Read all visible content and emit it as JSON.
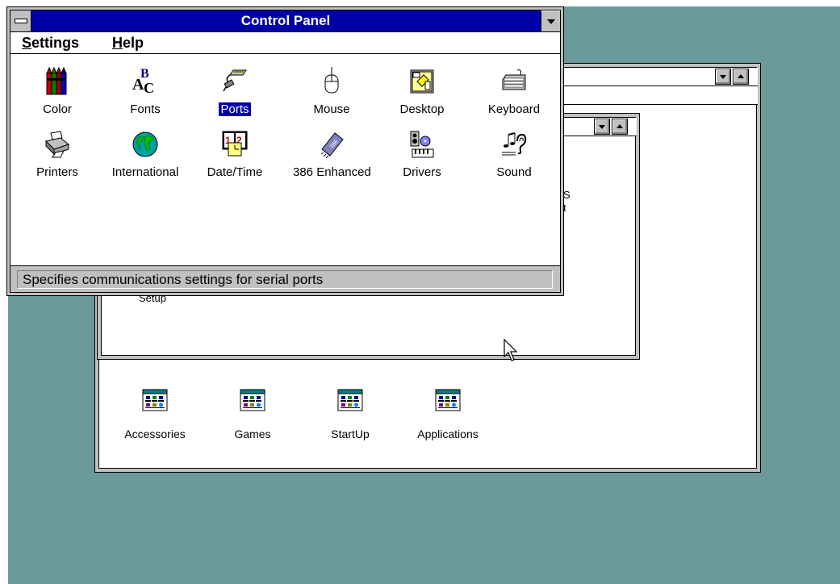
{
  "control_panel": {
    "title": "Control Panel",
    "menu": [
      {
        "label": "Settings",
        "accel": "S",
        "rest": "ettings"
      },
      {
        "label": "Help",
        "accel": "H",
        "rest": "elp"
      }
    ],
    "items": [
      {
        "label": "Color",
        "icon": "color-crayons-icon"
      },
      {
        "label": "Fonts",
        "icon": "fonts-icon"
      },
      {
        "label": "Ports",
        "icon": "ports-icon",
        "selected": true
      },
      {
        "label": "Mouse",
        "icon": "mouse-icon"
      },
      {
        "label": "Desktop",
        "icon": "desktop-icon"
      },
      {
        "label": "Keyboard",
        "icon": "keyboard-icon"
      },
      {
        "label": "Printers",
        "icon": "printer-icon"
      },
      {
        "label": "International",
        "icon": "globe-icon"
      },
      {
        "label": "Date/Time",
        "icon": "calendar-clock-icon"
      },
      {
        "label": "386 Enhanced",
        "icon": "chip-icon"
      },
      {
        "label": "Drivers",
        "icon": "drivers-icon"
      },
      {
        "label": "Sound",
        "icon": "sound-icon"
      }
    ],
    "status": "Specifies communications settings for serial ports"
  },
  "program_manager": {
    "groups": [
      {
        "label": "Accessories"
      },
      {
        "label": "Games"
      },
      {
        "label": "StartUp"
      },
      {
        "label": "Applications"
      }
    ],
    "partial_text": {
      "setup": "Setup",
      "s": "S",
      "t": "t"
    }
  },
  "colors": {
    "desktop": "#6b9898",
    "active_title": "#0000a8",
    "selection": "#0000a8",
    "face": "#c0c0c0"
  }
}
